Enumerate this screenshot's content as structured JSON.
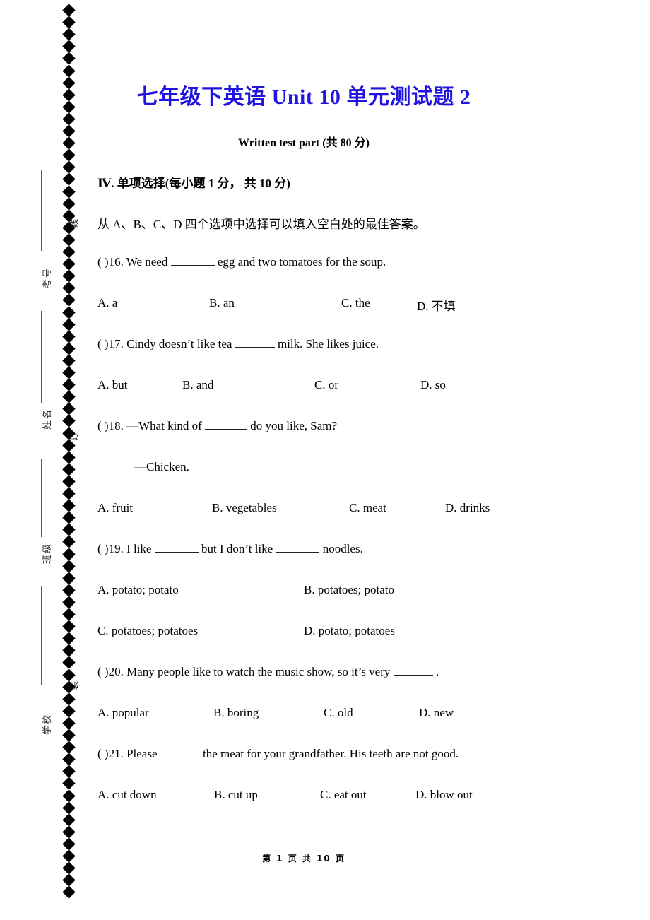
{
  "margin": {
    "labels": [
      {
        "text": "线",
        "kind": "seal"
      },
      {
        "text": "考号",
        "kind": "field"
      },
      {
        "text": "订",
        "kind": "seal"
      },
      {
        "text": "姓名",
        "kind": "field"
      },
      {
        "text": "班级",
        "kind": "field"
      },
      {
        "text": "装",
        "kind": "seal"
      },
      {
        "text": "学校",
        "kind": "field"
      }
    ],
    "diamond_count": 74
  },
  "document": {
    "title": "七年级下英语 Unit 10 单元测试题 2",
    "title_color": "#1f14e0",
    "subtitle": "Written test part (共 80 分)",
    "footer": "第 1 页 共 10 页"
  },
  "section": {
    "heading": "Ⅳ. 单项选择(每小题 1 分， 共 10 分)",
    "instruction": "从 A、B、C、D 四个选项中选择可以填入空白处的最佳答案。"
  },
  "questions": [
    {
      "number": "16",
      "marker": "(  )16.",
      "text_before": "We need",
      "text_after": "egg and two tomatoes for the soup.",
      "options": [
        {
          "key": "A.",
          "label": "a"
        },
        {
          "key": "B.",
          "label": "an"
        },
        {
          "key": "C.",
          "label": "the"
        },
        {
          "key": "D.",
          "label": "不填"
        }
      ]
    },
    {
      "number": "17",
      "marker": "(  )17.",
      "text_before": "Cindy doesn’t like tea",
      "text_after": "milk. She likes juice.",
      "options": [
        {
          "key": "A.",
          "label": "but"
        },
        {
          "key": "B.",
          "label": "and"
        },
        {
          "key": "C.",
          "label": "or"
        },
        {
          "key": "D.",
          "label": "so"
        }
      ]
    },
    {
      "number": "18",
      "marker": "(  )18.",
      "text_before": "—What kind of",
      "text_after": "do you like, Sam?",
      "continuation": "—Chicken.",
      "options": [
        {
          "key": "A.",
          "label": "fruit"
        },
        {
          "key": "B.",
          "label": "vegetables"
        },
        {
          "key": "C.",
          "label": "meat"
        },
        {
          "key": "D.",
          "label": "drinks"
        }
      ]
    },
    {
      "number": "19",
      "marker": "(  )19.",
      "text_before": "I like",
      "text_middle": "but I don’t like",
      "text_after": "noodles.",
      "options": [
        {
          "key": "A.",
          "label": "potato; potato"
        },
        {
          "key": "B.",
          "label": "potatoes; potato"
        },
        {
          "key": "C.",
          "label": "potatoes; potatoes"
        },
        {
          "key": "D.",
          "label": "potato; potatoes"
        }
      ]
    },
    {
      "number": "20",
      "marker": "(  )20.",
      "text_before": "Many people like to watch the music show, so it’s very",
      "text_after": ".",
      "options": [
        {
          "key": "A.",
          "label": "popular"
        },
        {
          "key": "B.",
          "label": "boring"
        },
        {
          "key": "C.",
          "label": "old"
        },
        {
          "key": "D.",
          "label": "new"
        }
      ]
    },
    {
      "number": "21",
      "marker": "(  )21.",
      "text_before": "Please",
      "text_after": "the meat for your grandfather. His teeth are not good.",
      "options": [
        {
          "key": "A.",
          "label": "cut down"
        },
        {
          "key": "B.",
          "label": "cut up"
        },
        {
          "key": "C.",
          "label": "eat out"
        },
        {
          "key": "D.",
          "label": "blow out"
        }
      ]
    }
  ]
}
